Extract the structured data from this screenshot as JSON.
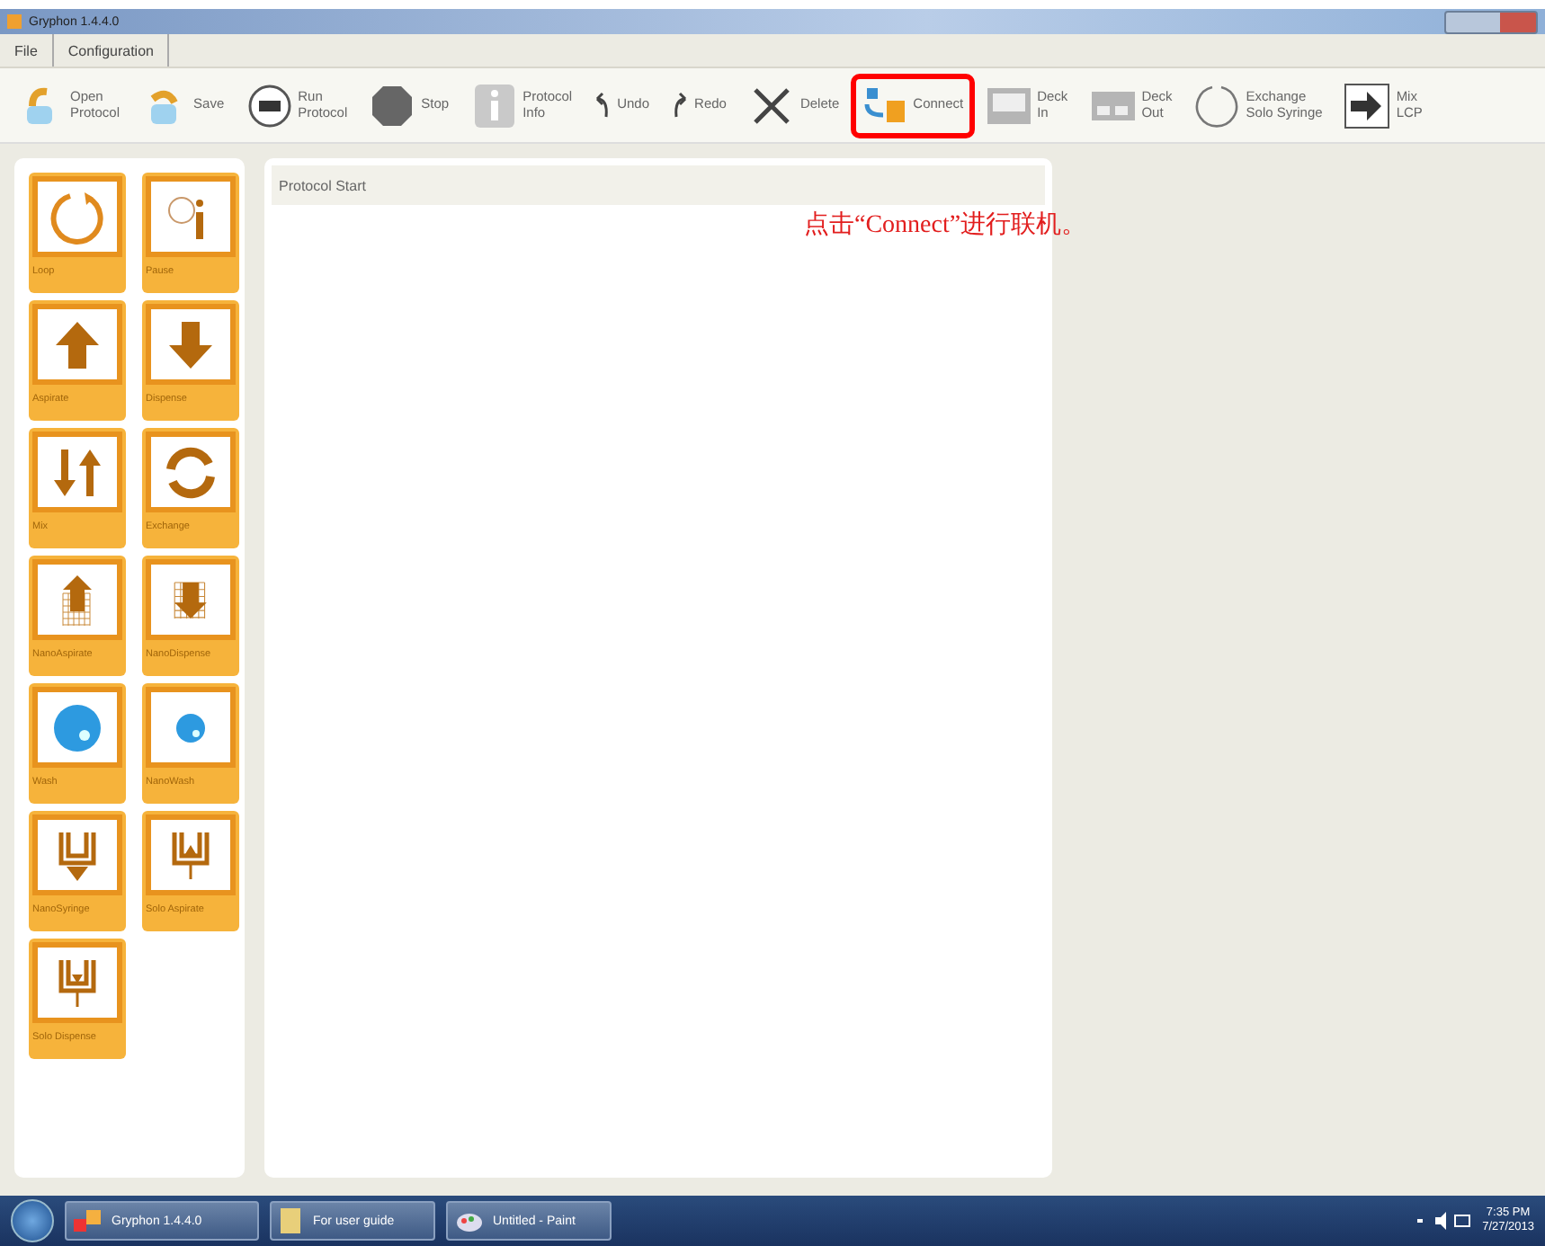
{
  "window": {
    "title": "Gryphon 1.4.4.0"
  },
  "menu": [
    "File",
    "Configuration"
  ],
  "toolbar": [
    {
      "kind": "open",
      "lines": [
        "Open",
        "Protocol"
      ],
      "highlighted": false
    },
    {
      "kind": "save",
      "lines": [
        "Save"
      ],
      "highlighted": false
    },
    {
      "kind": "go",
      "lines": [
        "Run",
        "Protocol"
      ],
      "highlighted": false
    },
    {
      "kind": "stop",
      "lines": [
        "Stop"
      ],
      "highlighted": false
    },
    {
      "kind": "info",
      "lines": [
        "Protocol",
        "Info"
      ],
      "highlighted": false
    },
    {
      "kind": "undo",
      "lines": [
        "Undo"
      ],
      "highlighted": false
    },
    {
      "kind": "redo",
      "lines": [
        "Redo"
      ],
      "highlighted": false
    },
    {
      "kind": "delete",
      "lines": [
        "Delete"
      ],
      "highlighted": false
    },
    {
      "kind": "connect",
      "lines": [
        "Connect"
      ],
      "highlighted": true
    },
    {
      "kind": "deckin",
      "lines": [
        "Deck",
        "In"
      ],
      "highlighted": false
    },
    {
      "kind": "deckout",
      "lines": [
        "Deck",
        "Out"
      ],
      "highlighted": false
    },
    {
      "kind": "exchange",
      "lines": [
        "Exchange",
        "Solo Syringe"
      ],
      "highlighted": false
    },
    {
      "kind": "arrow",
      "lines": [
        "Mix",
        "LCP"
      ],
      "highlighted": false
    }
  ],
  "palette": [
    {
      "kind": "loop",
      "label": "Loop"
    },
    {
      "kind": "pause",
      "label": "Pause"
    },
    {
      "kind": "up",
      "label": "Aspirate"
    },
    {
      "kind": "down",
      "label": "Dispense"
    },
    {
      "kind": "mix",
      "label": "Mix"
    },
    {
      "kind": "exchange",
      "label": "Exchange"
    },
    {
      "kind": "gridup",
      "label": "NanoAspirate"
    },
    {
      "kind": "griddown",
      "label": "NanoDispense"
    },
    {
      "kind": "ball",
      "label": "Wash"
    },
    {
      "kind": "smallball",
      "label": "NanoWash"
    },
    {
      "kind": "syringe",
      "label": "NanoSyringe"
    },
    {
      "kind": "soloasp",
      "label": "Solo Aspirate"
    },
    {
      "kind": "solodisp",
      "label": "Solo Dispense"
    }
  ],
  "protocol": {
    "header": "Protocol Start"
  },
  "annotation": "点击“Connect”进行联机。",
  "taskbar": {
    "items": [
      "Gryphon 1.4.4.0",
      "For user guide",
      "Untitled - Paint"
    ],
    "time": "7:35 PM",
    "date": "7/27/2013"
  }
}
